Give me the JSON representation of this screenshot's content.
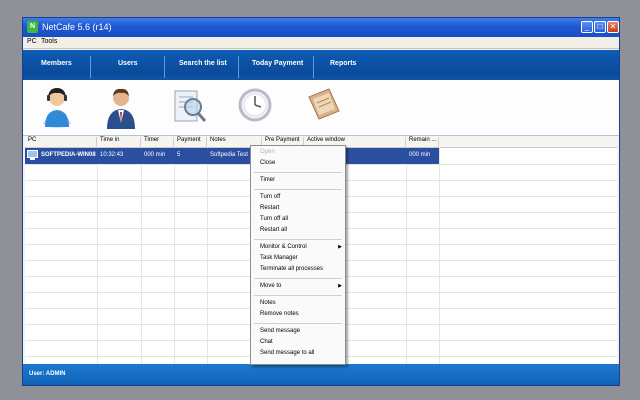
{
  "window": {
    "title": "NetCafe 5.6 (r14)",
    "app_icon_glyph": "N"
  },
  "menubar": {
    "items": [
      "PC",
      "Tools"
    ]
  },
  "nav": {
    "items": [
      "Members",
      "Users",
      "Search the list",
      "Today Payment",
      "Reports"
    ]
  },
  "icons": [
    "member-icon",
    "user-icon",
    "search-list-icon",
    "clock-icon",
    "report-book-icon"
  ],
  "grid": {
    "columns": [
      "PC",
      "Time in",
      "Timer",
      "Payment",
      "Notes",
      "Pre Payment",
      "Active window",
      "Remain ..."
    ],
    "rows": [
      {
        "pc": "SOFTPEDIA-WIN08",
        "time_in": "10:32:43",
        "timer": "000 min",
        "payment": "5",
        "notes": "Softpedia Test",
        "remain": "000 min"
      }
    ]
  },
  "context_menu": {
    "groups": [
      [
        {
          "label": "Open",
          "disabled": true
        },
        {
          "label": "Close"
        }
      ],
      [
        {
          "label": "Timer"
        }
      ],
      [
        {
          "label": "Turn off"
        },
        {
          "label": "Restart"
        },
        {
          "label": "Turn off all"
        },
        {
          "label": "Restart all"
        }
      ],
      [
        {
          "label": "Monitor & Control",
          "submenu": true
        },
        {
          "label": "Task Manager"
        },
        {
          "label": "Terminate all processes"
        }
      ],
      [
        {
          "label": "Move to",
          "submenu": true
        }
      ],
      [
        {
          "label": "Notes"
        },
        {
          "label": "Remove notes"
        }
      ],
      [
        {
          "label": "Send message"
        },
        {
          "label": "Chat"
        },
        {
          "label": "Send  message to all"
        }
      ]
    ]
  },
  "status": {
    "user": "User: ADMIN"
  },
  "colors": {
    "nav": "#0e5cb5",
    "selection": "#2a4ea0",
    "status": "#1d79cf"
  }
}
